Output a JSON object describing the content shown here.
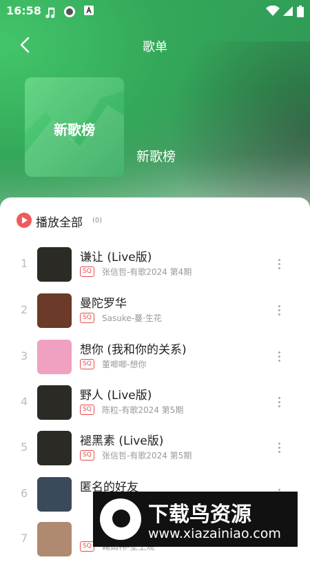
{
  "status_bar": {
    "time": "16:58"
  },
  "header": {
    "title": "歌单"
  },
  "playlist": {
    "cover_text": "新歌榜",
    "name": "新歌榜"
  },
  "play_all": {
    "label": "播放全部",
    "count": "(0)"
  },
  "quality_badge": "SQ",
  "songs": [
    {
      "index": "1",
      "title": "谦让 (Live版)",
      "subtitle": "张信哲-有歌2024 第4期",
      "thumb_color": "#2c2a24"
    },
    {
      "index": "2",
      "title": "曼陀罗华",
      "subtitle": "Sasuke-蔓·生花",
      "thumb_color": "#6b3a28"
    },
    {
      "index": "3",
      "title": "想你 (我和你的关系)",
      "subtitle": "董唧唧-想你",
      "thumb_color": "#f0a0c0"
    },
    {
      "index": "4",
      "title": "野人 (Live版)",
      "subtitle": "陈粒-有歌2024 第5期",
      "thumb_color": "#2c2a24"
    },
    {
      "index": "5",
      "title": "褪黑素 (Live版)",
      "subtitle": "张信哲-有歌2024 第5期",
      "thumb_color": "#2c2a24"
    },
    {
      "index": "6",
      "title": "匿名的好友",
      "subtitle": "",
      "thumb_color": "#3a4a5a"
    },
    {
      "index": "7",
      "title": "",
      "subtitle": "鞠婧祎-壁上观",
      "thumb_color": "#b08a70"
    }
  ],
  "watermark": {
    "title": "下载鸟资源",
    "url": "www.xiazainiao.com"
  },
  "colors": {
    "accent_green": "#34a85a",
    "play_red": "#f05a5a",
    "sq_red": "#e94b4b"
  }
}
